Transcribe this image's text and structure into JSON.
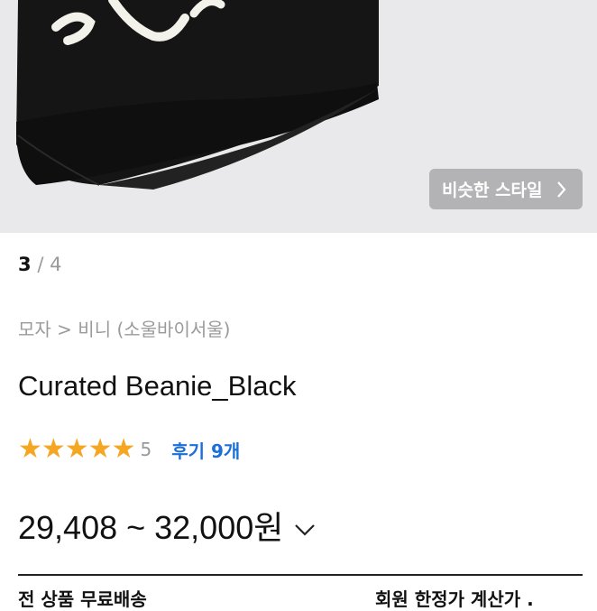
{
  "gallery": {
    "similar_style_label": "비슷한 스타일",
    "current_index": "3",
    "separator": "/",
    "total": "4"
  },
  "breadcrumb": {
    "category": "모자",
    "arrow": ">",
    "subcategory": "비니 (소울바이서울)"
  },
  "product": {
    "name": "Curated Beanie_Black",
    "stars": "★★★★★",
    "rating": "5",
    "reviews_label": "후기 9개",
    "price_range": "29,408 ~ 32,000원"
  },
  "shipping": {
    "left_text": "전 상품 무료배송",
    "right_text": "회원 한정가 계산가 ."
  },
  "colors": {
    "star": "#f5a623",
    "review_link": "#1a6fd8",
    "hero_bg": "#e9e9eb",
    "button_bg": "#b3b3b5"
  }
}
